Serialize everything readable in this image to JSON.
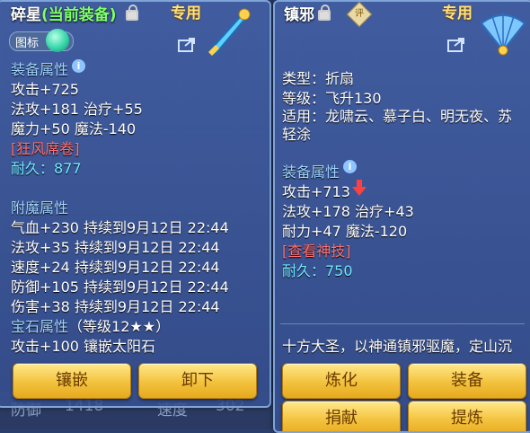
{
  "background": {
    "footer_left": "防御",
    "footer_left_val": "1418",
    "footer_right": "速度",
    "footer_right_val": "302"
  },
  "left": {
    "title_name": "碎星",
    "title_status": "(当前装备)",
    "special_label": "专用",
    "tag_label": "图标",
    "section_attr": "装备属性",
    "attr_lines": [
      "攻击+725",
      "法攻+181 治疗+55",
      "魔力+50 魔法-140"
    ],
    "special_skill": "[狂风席卷]",
    "durability": "耐久：877",
    "section_enchant": "附魔属性",
    "enchant_lines": [
      "气血+230 持续到9月12日 22:44",
      "法攻+35 持续到9月12日 22:44",
      "速度+24 持续到9月12日 22:44",
      "防御+105 持续到9月12日 22:44",
      "伤害+38 持续到9月12日 22:44"
    ],
    "section_gem": "宝石属性",
    "gem_level": "（等级12★★）",
    "gem_line": "攻击+100 镶嵌太阳石",
    "buttons": {
      "inlay": "镶嵌",
      "unequip": "卸下"
    }
  },
  "right": {
    "title_name": "镇邪",
    "badge": "评",
    "special_label": "专用",
    "type_line": "类型：折扇",
    "level_line": "等级：飞升130",
    "suit_line1": "适用：龙啸云、慕子白、明无夜、苏",
    "suit_line2": "轻涂",
    "section_attr": "装备属性",
    "attr_lines": [
      "攻击+713",
      "法攻+178 治疗+43",
      "耐力+47 魔法-120"
    ],
    "skill_link": "[查看神技]",
    "durability": "耐久：750",
    "desc": "十方大圣，以神通镇邪驱魔，定山沉",
    "buttons": {
      "refine": "炼化",
      "equip": "装备",
      "donate": "捐献",
      "extract": "提炼"
    }
  },
  "colors": {
    "button_gold": "#f3c23d",
    "title_green": "#7fff6a",
    "section_blue": "#9fd3ff",
    "skill_red": "#ff6f6f",
    "durability_cyan": "#6fe8ff"
  }
}
